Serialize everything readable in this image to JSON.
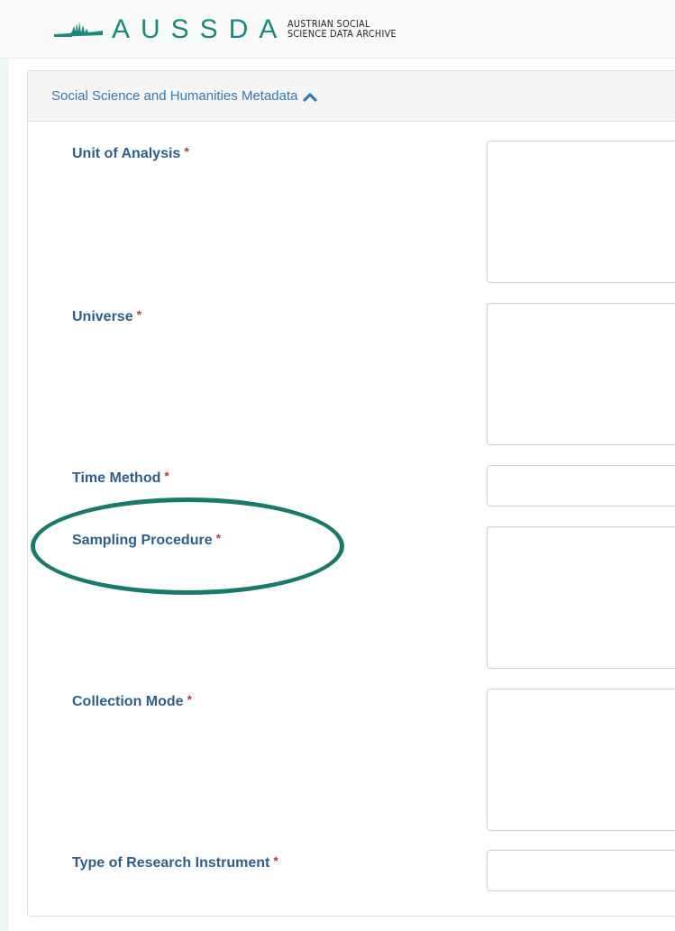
{
  "header": {
    "logo_text": "AUSSDA",
    "logo_sub_line1": "AUSTRIAN SOCIAL",
    "logo_sub_line2": "SCIENCE DATA ARCHIVE"
  },
  "panel": {
    "heading": "Social Science and Humanities Metadata",
    "heading_icon": "chevron-up-icon"
  },
  "fields": [
    {
      "label": "Unit of Analysis",
      "required_marker": "*",
      "value": ""
    },
    {
      "label": "Universe",
      "required_marker": "*",
      "value": ""
    },
    {
      "label": "Time Method",
      "required_marker": "*",
      "value": ""
    },
    {
      "label": "Sampling Procedure",
      "required_marker": "*",
      "value": ""
    },
    {
      "label": "Collection Mode",
      "required_marker": "*",
      "value": ""
    },
    {
      "label": "Type of Research Instrument",
      "required_marker": "*",
      "value": ""
    }
  ],
  "colors": {
    "brand": "#1c8a7a",
    "label": "#2e5f8a",
    "required": "#a94442",
    "highlight_ellipse": "#197a6c"
  }
}
